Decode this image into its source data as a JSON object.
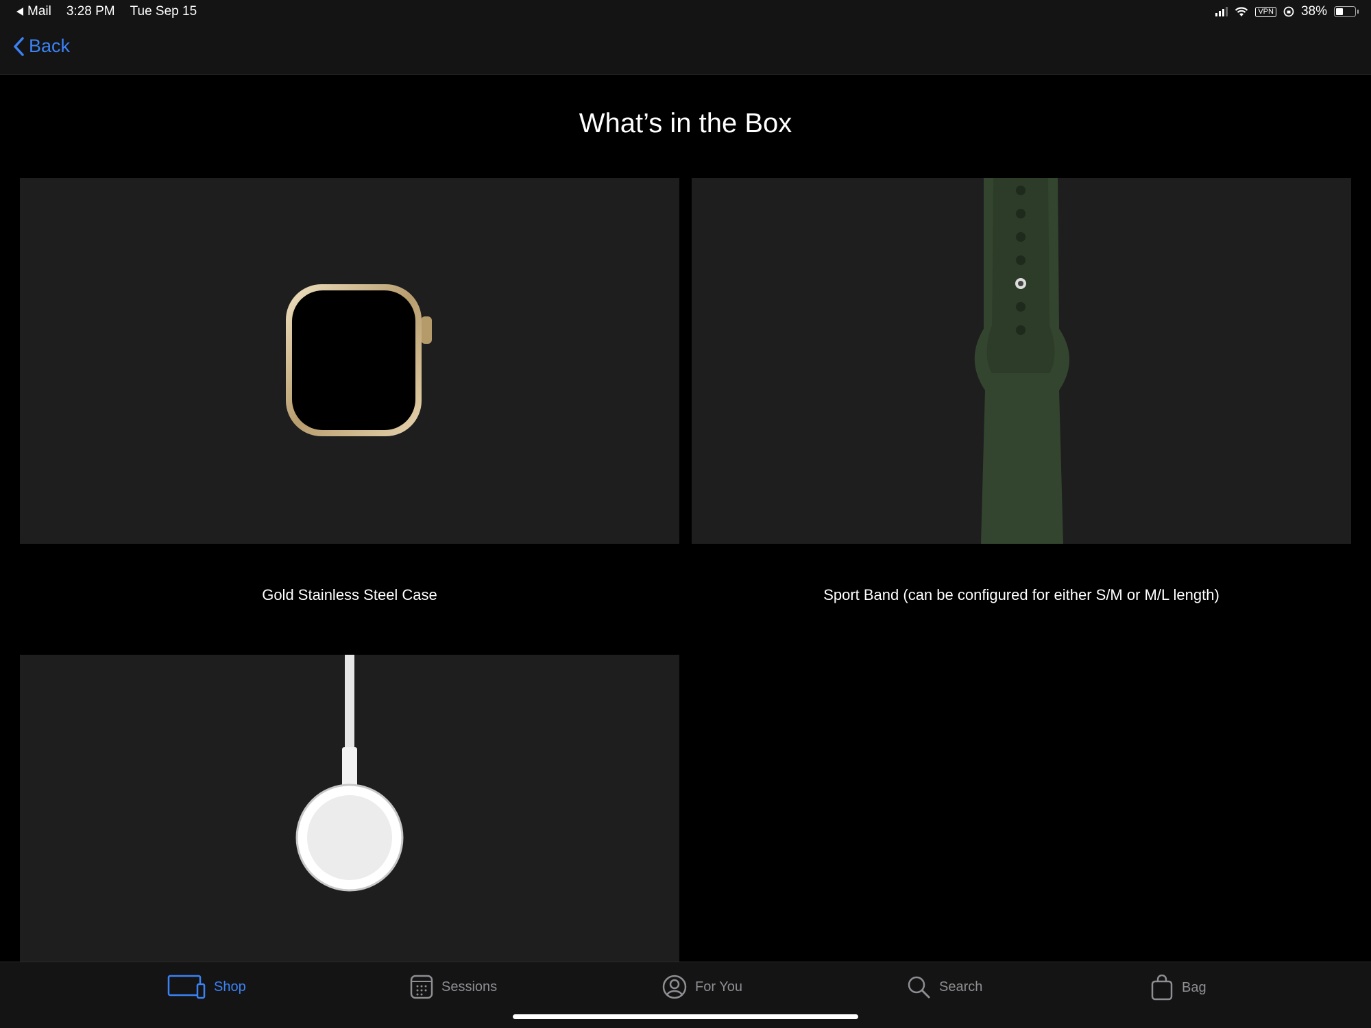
{
  "status_bar": {
    "back_app": "Mail",
    "time": "3:28 PM",
    "date": "Tue Sep 15",
    "vpn": "VPN",
    "battery": "38%",
    "battery_level": 0.38
  },
  "nav": {
    "back_label": "Back"
  },
  "page": {
    "title": "What’s in the Box",
    "items": [
      {
        "caption": "Gold Stainless Steel Case",
        "image": "gold-watch-case"
      },
      {
        "caption": "Sport Band (can be configured for either S/M or M/L length)",
        "image": "green-sport-band"
      },
      {
        "caption": "",
        "image": "magnetic-charger"
      }
    ]
  },
  "tab_bar": {
    "tabs": [
      {
        "label": "Shop",
        "icon": "devices-icon",
        "active": true
      },
      {
        "label": "Sessions",
        "icon": "calendar-icon",
        "active": false
      },
      {
        "label": "For You",
        "icon": "person-circle-icon",
        "active": false
      },
      {
        "label": "Search",
        "icon": "search-icon",
        "active": false
      },
      {
        "label": "Bag",
        "icon": "bag-icon",
        "active": false
      }
    ]
  },
  "colors": {
    "accent": "#3b82f6",
    "background": "#000000",
    "card": "#1e1e1f",
    "band_green": "#34452f",
    "watch_gold": "#c9b58c"
  }
}
